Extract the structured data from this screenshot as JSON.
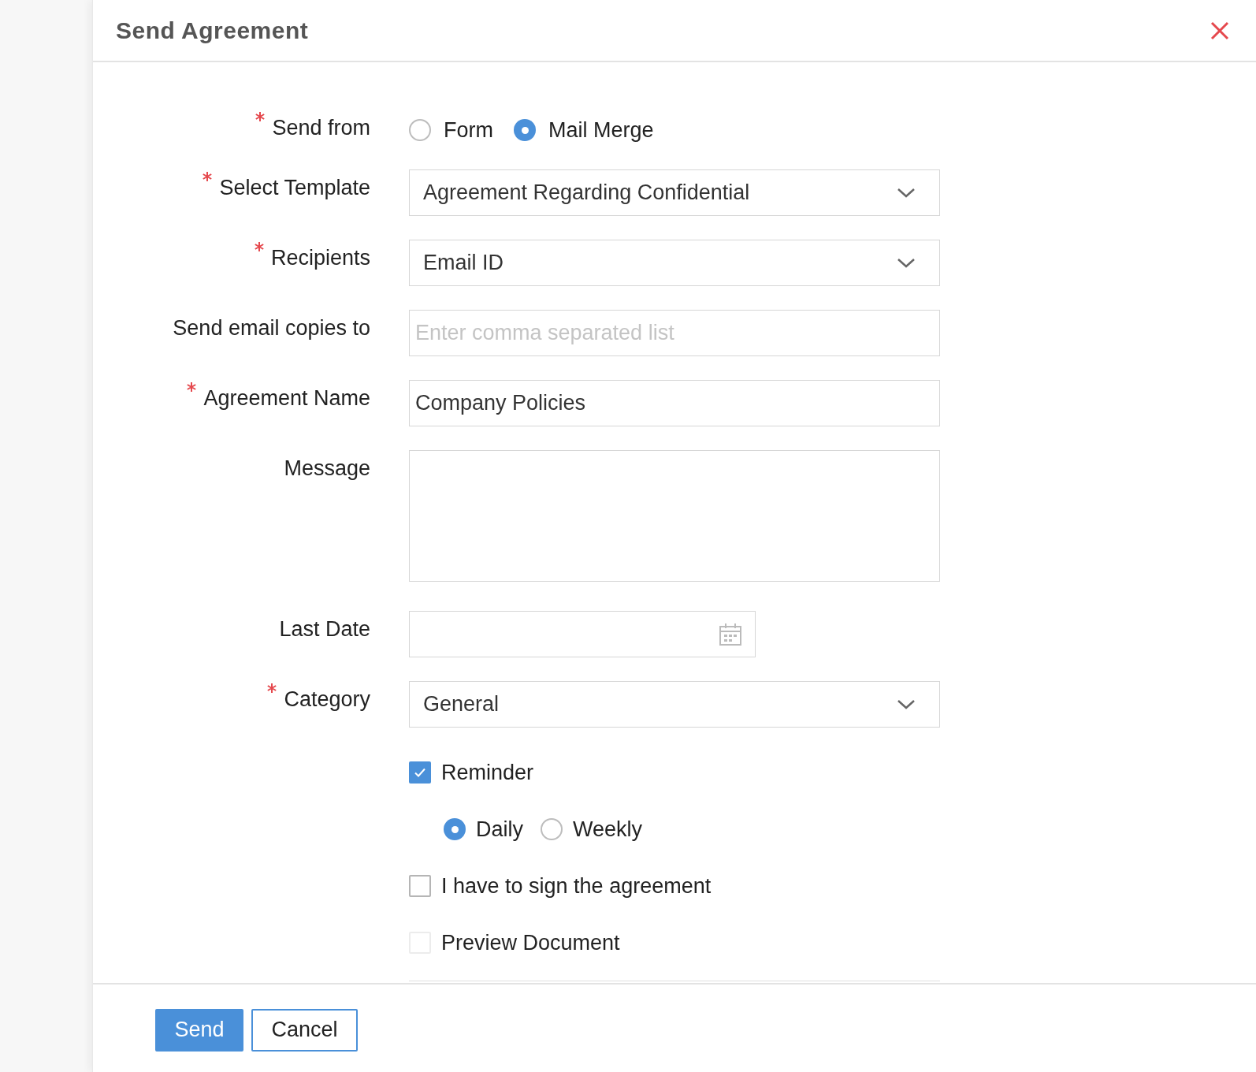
{
  "dialog": {
    "title": "Send Agreement"
  },
  "fields": [
    {
      "kind": "radio",
      "label": "Send from",
      "required": true,
      "options": [
        {
          "label": "Form",
          "selected": false
        },
        {
          "label": "Mail Merge",
          "selected": true
        }
      ]
    },
    {
      "kind": "select",
      "label": "Select Template",
      "required": true,
      "value": "Agreement Regarding Confidential"
    },
    {
      "kind": "select",
      "label": "Recipients",
      "required": true,
      "value": "Email ID"
    },
    {
      "kind": "text",
      "label": "Send email copies to",
      "required": false,
      "placeholder": "Enter comma separated list"
    },
    {
      "kind": "text",
      "label": "Agreement Name",
      "required": true,
      "value": "Company Policies"
    },
    {
      "kind": "textarea",
      "label": "Message",
      "required": false
    },
    {
      "kind": "date",
      "label": "Last Date",
      "required": false
    },
    {
      "kind": "select",
      "label": "Category",
      "required": true,
      "value": "General"
    }
  ],
  "reminder": {
    "label": "Reminder",
    "checked": true,
    "frequency": [
      {
        "label": "Daily",
        "selected": true
      },
      {
        "label": "Weekly",
        "selected": false
      }
    ]
  },
  "options": [
    {
      "label": "I have to sign the agreement",
      "checked": false,
      "disabled": false
    },
    {
      "label": "Preview Document",
      "checked": false,
      "disabled": true
    }
  ],
  "buttons": [
    {
      "label": "Send",
      "kind": "primary"
    },
    {
      "label": "Cancel",
      "kind": "secondary"
    }
  ]
}
